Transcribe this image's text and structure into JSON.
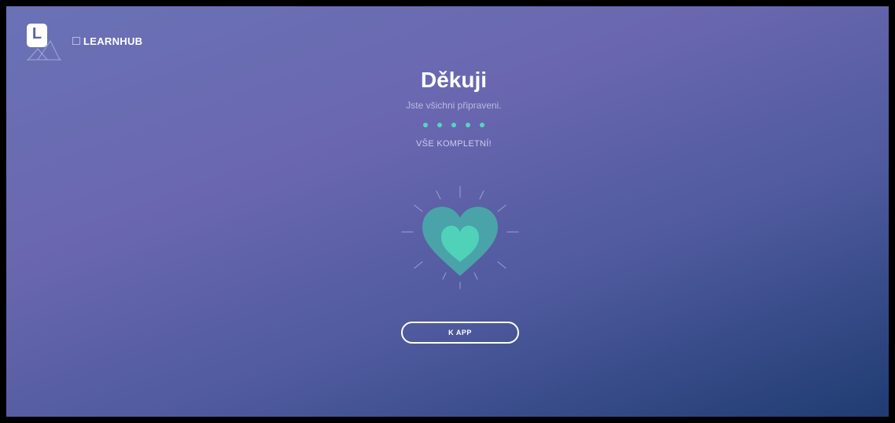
{
  "brand": {
    "logo_letter": "L",
    "name": "LEARNHUB"
  },
  "main": {
    "title": "Děkuji",
    "subtitle": "Jste všichni připraveni.",
    "progress_steps_completed": 5,
    "progress_steps_total": 5,
    "status": "VŠE KOMPLETNÍ!",
    "illustration_icon": "heart-icon",
    "cta_label": "K APP"
  },
  "colors": {
    "accent": "#52d6c3",
    "heart_outer": "#4aa3a8",
    "heart_inner": "#4fd2b8",
    "bg_top": "#6a72b6",
    "bg_bottom": "#1f3c72"
  }
}
